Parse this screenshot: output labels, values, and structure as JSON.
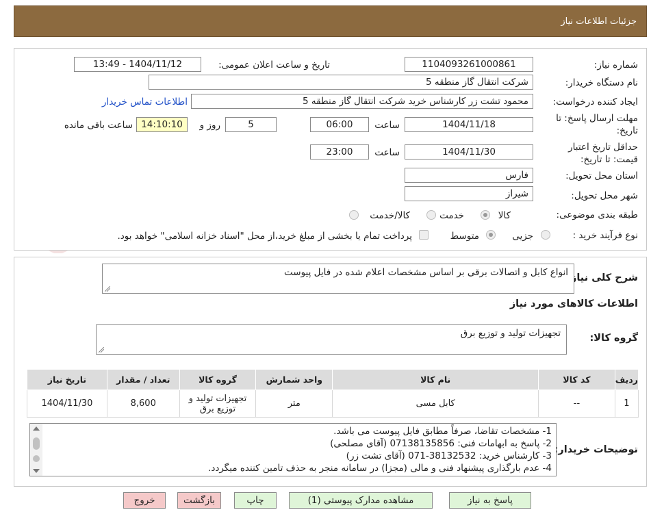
{
  "header": {
    "title": "جزئیات اطلاعات نیاز"
  },
  "watermark": {
    "text": "AriaTender.neT"
  },
  "form": {
    "need_number_label": "شماره نیاز:",
    "need_number": "1104093261000861",
    "announce_label": "تاریخ و ساعت اعلان عمومی:",
    "announce_value": "1404/11/12 - 13:49",
    "buyer_label": "نام دستگاه خریدار:",
    "buyer_value": "شرکت انتقال گاز منطقه 5",
    "creator_label": "ایجاد کننده درخواست:",
    "creator_value": "محمود تشت زر کارشناس خرید شرکت انتقال گاز منطقه 5",
    "contact_link": "اطلاعات تماس خریدار",
    "reply_label_1": "مهلت ارسال پاسخ: تا",
    "reply_label_2": "تاریخ:",
    "reply_date": "1404/11/18",
    "time_label": "ساعت",
    "reply_time": "06:00",
    "days_value": "5",
    "days_label": "روز و",
    "remaining_time": "14:10:10",
    "remaining_label": "ساعت باقی مانده",
    "validity_label_1": "حداقل تاریخ اعتبار",
    "validity_label_2": "قیمت: تا تاریخ:",
    "validity_date": "1404/11/30",
    "validity_time": "23:00",
    "province_label": "استان محل تحویل:",
    "province_value": "فارس",
    "city_label": "شهر محل تحویل:",
    "city_value": "شیراز",
    "category_label": "طبقه بندی موضوعی:",
    "category_options": [
      "کالا",
      "خدمت",
      "کالا/خدمت"
    ],
    "process_label": "نوع فرآیند خرید :",
    "process_options": [
      "جزیی",
      "متوسط"
    ],
    "payment_note": "پرداخت تمام یا بخشی از مبلغ خرید،از محل \"اسناد خزانه اسلامی\" خواهد بود."
  },
  "summary": {
    "label": "شرح کلی نیاز:",
    "value": "انواع کابل و اتصالات برقی بر اساس مشخصات اعلام شده در فایل پیوست"
  },
  "goods": {
    "section_title": "اطلاعات کالاهای مورد نیاز",
    "group_label": "گروه کالا:",
    "group_value": "تجهیزات تولید و توزیع برق"
  },
  "table": {
    "headers": [
      "ردیف",
      "کد کالا",
      "نام کالا",
      "واحد شمارش",
      "گروه کالا",
      "تعداد / مقدار",
      "تاریخ نیاز"
    ],
    "rows": [
      {
        "row": "1",
        "code": "--",
        "name": "کابل مسی",
        "unit": "متر",
        "group": "تجهیزات تولید و توزیع برق",
        "qty": "8,600",
        "date": "1404/11/30"
      }
    ]
  },
  "notes": {
    "label": "توضیحات خریدار:",
    "lines": [
      "1-  مشخصات تقاضا، صرفاً مطابق فایل پیوست می باشد.",
      "2- پاسخ به ابهامات فنی: 07138135856 (آقای مصلحی)",
      "3- کارشناس خرید: 38132532-071 (آقای تشت زر)",
      "4- عدم بارگذاری پیشنهاد فنی و مالی (مجزا) در سامانه منجر به حذف تامین کننده میگردد."
    ]
  },
  "buttons": {
    "reply": "پاسخ به نیاز",
    "attachments": "مشاهده مدارک پیوستی (1)",
    "print": "چاپ",
    "back": "بازگشت",
    "exit": "خروج"
  },
  "colors": {
    "header_bg": "#8c6a3f",
    "link": "#1f4fc7",
    "remaining_bg": "#ffffc4",
    "green_button": "#dff5d8",
    "pink_button": "#f5c9c9"
  }
}
